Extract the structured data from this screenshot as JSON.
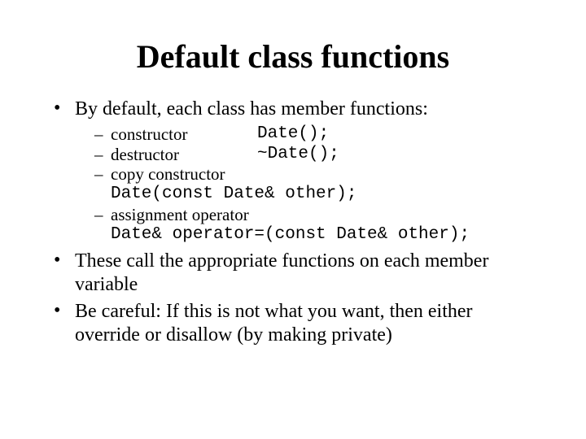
{
  "title": "Default class functions",
  "bullets": {
    "b1": "By default, each class has member functions:",
    "b2": "These call the appropriate functions on each member variable",
    "b3": "Be careful:  If this is not what you want, then either override or disallow (by making private)"
  },
  "members": {
    "m1": {
      "label": "constructor",
      "code": "Date();"
    },
    "m2": {
      "label": "destructor",
      "code": "~Date();"
    },
    "m3": {
      "label": "copy constructor",
      "code": "Date(const Date& other);"
    },
    "m4": {
      "label": "assignment operator",
      "code": "Date& operator=(const Date& other);"
    }
  }
}
